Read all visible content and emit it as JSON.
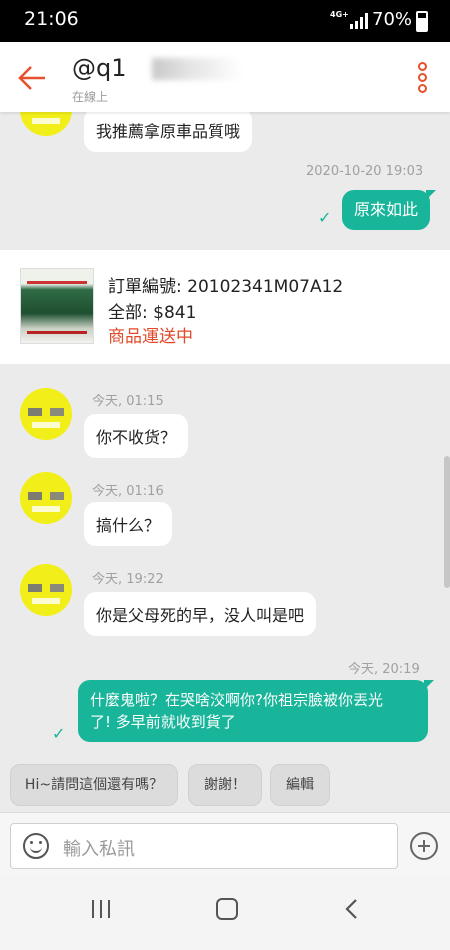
{
  "status_bar": {
    "time": "21:06",
    "network": "4G+",
    "battery": "70%"
  },
  "header": {
    "title": "@q1",
    "status": "在線上"
  },
  "messages": {
    "partial_in": "我推薦拿原車品質哦",
    "date_1": "2020-10-20 19:03",
    "out_1": "原來如此",
    "order": {
      "number": "訂單編號: 20102341M07A12",
      "total": "全部: $841",
      "status": "商品運送中"
    },
    "time_2": "今天, 01:15",
    "in_2": "你不收货？",
    "time_3": "今天, 01:16",
    "in_3": "搞什么？",
    "time_4": "今天, 19:22",
    "in_4": "你是父母死的早，没人叫是吧",
    "time_5": "今天, 20:19",
    "out_2_line1": "什麼鬼啦？在哭啥洨啊你?你祖宗臉被你丟光",
    "out_2_line2": "了! 多早前就收到貨了"
  },
  "quick_replies": [
    "Hi~請問這個還有嗎？",
    "謝謝！",
    "編輯"
  ],
  "input": {
    "placeholder": "輸入私訊"
  },
  "colors": {
    "accent": "#e8502c",
    "bubble_out": "#18b59a",
    "order_status": "#e04a2a"
  },
  "icons": [
    "back-arrow-icon",
    "more-vertical-icon",
    "smiley-icon",
    "plus-icon",
    "read-check-icon",
    "recent-apps-icon",
    "home-icon",
    "nav-back-icon"
  ]
}
